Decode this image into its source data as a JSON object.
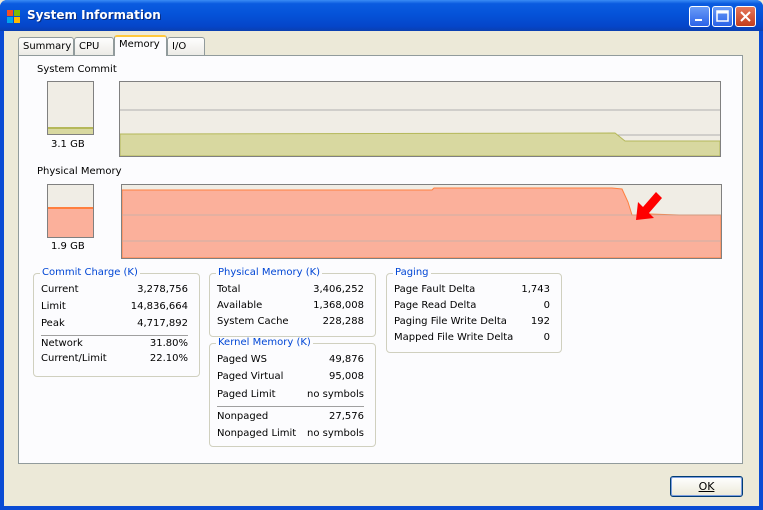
{
  "window": {
    "title": "System Information",
    "icon": "system-information-icon"
  },
  "tabs": [
    {
      "label": "Summary"
    },
    {
      "label": "CPU"
    },
    {
      "label": "Memory"
    },
    {
      "label": "I/O"
    }
  ],
  "active_tab": "Memory",
  "system_commit": {
    "label": "System Commit",
    "value": "3.1 GB",
    "bar_level": 0.14,
    "color": "#b5b85a",
    "fill_color": "#d8d8a0"
  },
  "physical_memory_graph": {
    "label": "Physical Memory",
    "value": "1.9 GB",
    "bar_level": 0.58,
    "color": "#ff7f3f",
    "fill_color": "#fbb09b"
  },
  "commit_charge": {
    "title": "Commit Charge (K)",
    "rows": [
      {
        "key": "Current",
        "value": "3,278,756"
      },
      {
        "key": "Limit",
        "value": "14,836,664"
      },
      {
        "key": "Peak",
        "value": "4,717,892"
      },
      {
        "key": "Network",
        "value": "31.80%"
      },
      {
        "key": "Current/Limit",
        "value": "22.10%"
      }
    ]
  },
  "physical_memory": {
    "title": "Physical Memory (K)",
    "rows": [
      {
        "key": "Total",
        "value": "3,406,252"
      },
      {
        "key": "Available",
        "value": "1,368,008"
      },
      {
        "key": "System Cache",
        "value": "228,288"
      }
    ]
  },
  "kernel_memory": {
    "title": "Kernel Memory (K)",
    "rows": [
      {
        "key": "Paged WS",
        "value": "49,876"
      },
      {
        "key": "Paged Virtual",
        "value": "95,008"
      },
      {
        "key": "Paged Limit",
        "value": "no symbols"
      },
      {
        "key": "Nonpaged",
        "value": "27,576"
      },
      {
        "key": "Nonpaged Limit",
        "value": "no symbols"
      }
    ]
  },
  "paging": {
    "title": "Paging",
    "rows": [
      {
        "key": "Page Fault Delta",
        "value": "1,743"
      },
      {
        "key": "Page Read Delta",
        "value": "0"
      },
      {
        "key": "Paging File Write Delta",
        "value": "192"
      },
      {
        "key": "Mapped File Write Delta",
        "value": "0"
      }
    ]
  },
  "ok_button": {
    "label": "OK"
  },
  "annotation": {
    "color": "#ff0000",
    "icon": "red-arrow-icon"
  }
}
